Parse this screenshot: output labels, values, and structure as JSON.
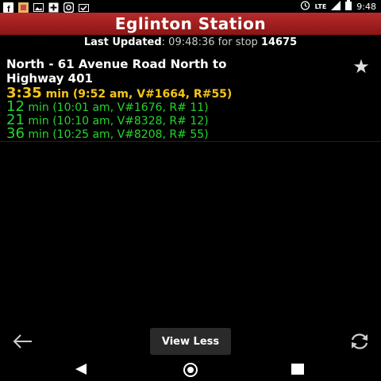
{
  "status_bar": {
    "time": "9:48",
    "network": "LTE",
    "left_icons": [
      "facebook-icon",
      "photo-icon",
      "image-icon",
      "plus-box-icon",
      "instagram-icon",
      "mail-check-icon"
    ],
    "right_icons": [
      "alarm-icon",
      "signal-icon",
      "battery-icon"
    ]
  },
  "title": "Eglinton Station",
  "last_updated": {
    "label": "Last Updated",
    "text": ": 09:48:36 for stop ",
    "stop": "14675"
  },
  "route": {
    "line1": "North - 61 Avenue Road North to",
    "line2": "Highway 401",
    "favorite_icon": "star-icon"
  },
  "predictions": [
    {
      "main": "3:35",
      "unit": " min",
      "detail": " (9:52 am, V#1664, R#55)"
    },
    {
      "main": "12",
      "unit": " min",
      "detail": " (10:01 am, V#1676, R# 11)"
    },
    {
      "main": "21",
      "unit": " min",
      "detail": " (10:10 am, V#8328, R# 12)"
    },
    {
      "main": "36",
      "unit": " min",
      "detail": " (10:25 am, V#8208, R# 55)"
    }
  ],
  "bottom": {
    "view_less": "View Less",
    "back_icon": "arrow-left-icon",
    "refresh_icon": "refresh-icon"
  },
  "colors": {
    "title_bar": "#9a1a1a",
    "first_prediction": "#f5c518",
    "other_predictions": "#25d52d"
  }
}
